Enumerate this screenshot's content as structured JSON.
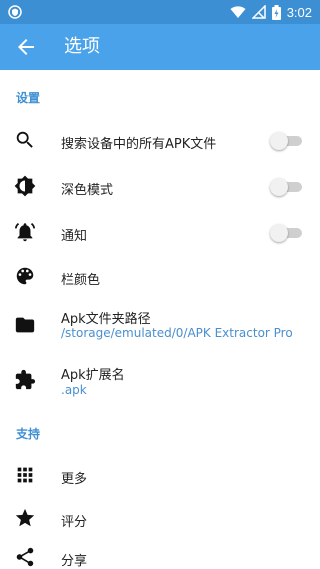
{
  "status_bar": {
    "time": "3:02"
  },
  "app_bar": {
    "title": "选项"
  },
  "sections": {
    "settings": "设置",
    "support": "支持"
  },
  "items": {
    "search": {
      "label": "搜索设备中的所有APK文件",
      "toggle_on": false
    },
    "dark_mode": {
      "label": "深色模式",
      "toggle_on": false
    },
    "notifications": {
      "label": "通知",
      "toggle_on": false
    },
    "bar_color": {
      "label": "栏颜色"
    },
    "apk_path": {
      "label": "Apk文件夹路径",
      "value": "/storage/emulated/0/APK Extractor Pro"
    },
    "apk_ext": {
      "label": "Apk扩展名",
      "value": ".apk"
    },
    "more": {
      "label": "更多"
    },
    "rate": {
      "label": "评分"
    },
    "share": {
      "label": "分享"
    }
  },
  "colors": {
    "status_bar": "#3d8fd3",
    "app_bar": "#4aa3ea",
    "accent": "#3d8fd3",
    "toggle_track_off": "#cfcfcf"
  }
}
